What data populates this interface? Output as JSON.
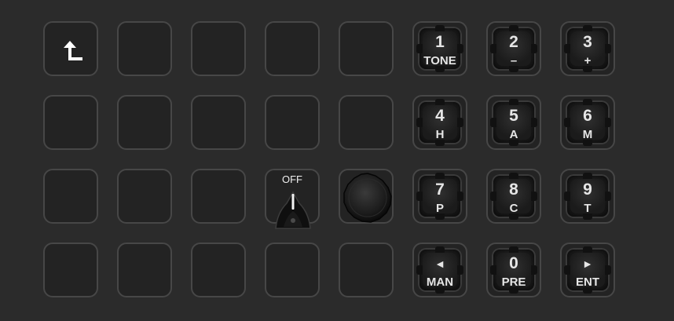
{
  "grid": {
    "back_icon": "arrow-up-left-icon",
    "knob": {
      "label": "OFF"
    },
    "keys": [
      {
        "main": "1",
        "sub": "TONE"
      },
      {
        "main": "2",
        "sub": "–"
      },
      {
        "main": "3",
        "sub": "+"
      },
      {
        "main": "4",
        "sub": "H"
      },
      {
        "main": "5",
        "sub": "A"
      },
      {
        "main": "6",
        "sub": "M"
      },
      {
        "main": "7",
        "sub": "P"
      },
      {
        "main": "8",
        "sub": "C"
      },
      {
        "main": "9",
        "sub": "T"
      },
      {
        "main": "◄",
        "sub": "MAN"
      },
      {
        "main": "0",
        "sub": "PRE"
      },
      {
        "main": "►",
        "sub": "ENT"
      }
    ]
  }
}
